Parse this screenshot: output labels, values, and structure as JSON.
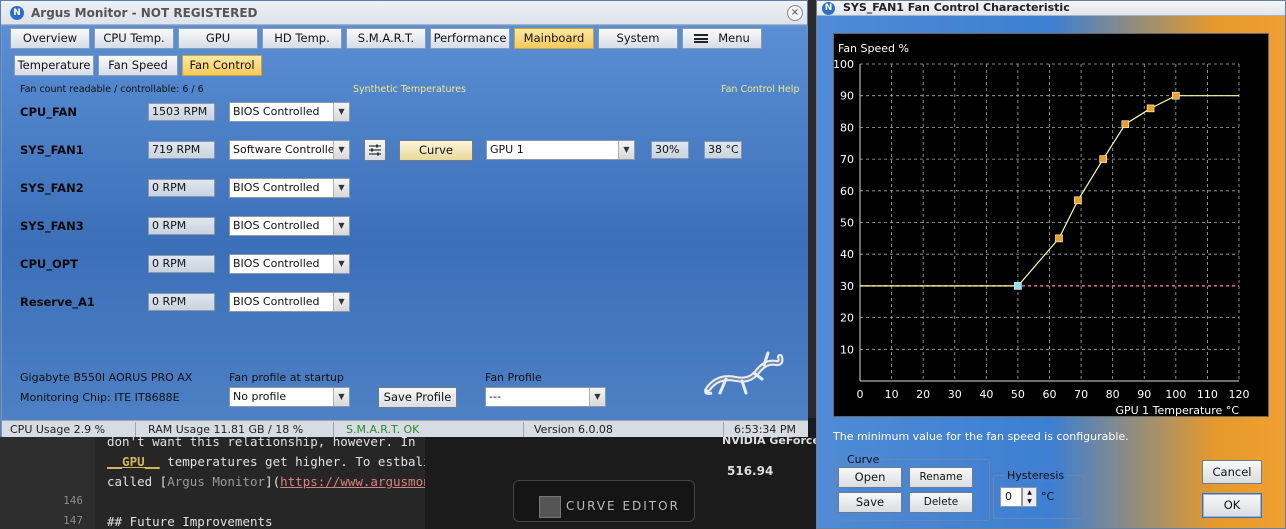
{
  "background": {
    "line_numbers": [
      "146",
      "147"
    ],
    "code_line1": "don't want this relationship, however. In",
    "code_line2_prefix": "",
    "code_line2_kw": "__GPU__",
    "code_line2_rest": " temperatures get higher. To estbalish this relationship, we have to use",
    "code_line3_prefix": "called [",
    "code_line3_link": "Argus Monitor",
    "code_line3_mid": "](",
    "code_line3_url": "https://www.argusmonitor.com",
    "code_line4": "## Future Improvements",
    "nvidia_label": "NVIDIA GeForce",
    "nvidia_value": "516.94",
    "curve_editor_label": "CURVE EDITOR"
  },
  "main_window": {
    "title": "Argus Monitor - NOT REGISTERED",
    "close_glyph": "×",
    "tabs": [
      "Overview",
      "CPU Temp.",
      "GPU",
      "HD Temp.",
      "S.M.A.R.T.",
      "Performance",
      "Mainboard",
      "System",
      "Menu"
    ],
    "active_tab": "Mainboard",
    "subtabs": [
      "Temperature",
      "Fan Speed",
      "Fan Control"
    ],
    "active_subtab": "Fan Control",
    "fan_count": "Fan count readable / controllable: 6 / 6",
    "synthetic_temps": "Synthetic Temperatures",
    "fan_help": "Fan Control Help",
    "fans": [
      {
        "name": "CPU_FAN",
        "rpm": "1503 RPM",
        "mode": "BIOS Controlled"
      },
      {
        "name": "SYS_FAN1",
        "rpm": "719 RPM",
        "mode": "Software Controlled"
      },
      {
        "name": "SYS_FAN2",
        "rpm": "0 RPM",
        "mode": "BIOS Controlled"
      },
      {
        "name": "SYS_FAN3",
        "rpm": "0 RPM",
        "mode": "BIOS Controlled"
      },
      {
        "name": "CPU_OPT",
        "rpm": "0 RPM",
        "mode": "BIOS Controlled"
      },
      {
        "name": "Reserve_A1",
        "rpm": "0 RPM",
        "mode": "BIOS Controlled"
      }
    ],
    "sys_fan1_controls": {
      "curve_label": "Curve",
      "source": "GPU 1",
      "percent": "30%",
      "temp": "38 °C"
    },
    "board": "Gigabyte B550I AORUS PRO AX",
    "chip": "Monitoring Chip: ITE IT8688E",
    "profile_startup_label": "Fan profile at startup",
    "profile_startup_value": "No profile",
    "save_profile": "Save Profile",
    "fan_profile_label": "Fan Profile",
    "fan_profile_value": "---",
    "status": {
      "cpu": "CPU Usage 2.9 %",
      "ram": "RAM Usage 11.81 GB / 18 %",
      "smart": "S.M.A.R.T. OK",
      "version": "Version 6.0.08",
      "time": "6:53:34 PM"
    }
  },
  "fan_control_window": {
    "title": "SYS_FAN1 Fan Control Characteristic",
    "close_glyph": "×",
    "note": "The minimum value for the fan speed is configurable.",
    "curve_group": "Curve",
    "buttons": {
      "open": "Open",
      "rename": "Rename",
      "save": "Save",
      "delete": "Delete",
      "cancel": "Cancel",
      "ok": "OK"
    },
    "hysteresis_label": "Hysteresis",
    "hysteresis_value": "0",
    "hysteresis_unit": "°C"
  },
  "chart_data": {
    "type": "line",
    "title": "",
    "ylabel": "Fan Speed %",
    "xlabel": "GPU 1  Temperature °C",
    "xlim": [
      0,
      120
    ],
    "ylim": [
      0,
      100
    ],
    "x_ticks": [
      0,
      10,
      20,
      30,
      40,
      50,
      60,
      70,
      80,
      90,
      100,
      110,
      120
    ],
    "y_ticks": [
      10,
      20,
      30,
      40,
      50,
      60,
      70,
      80,
      90,
      100
    ],
    "grid": true,
    "series": [
      {
        "points": [
          [
            0,
            30
          ],
          [
            50,
            30
          ],
          [
            63,
            45
          ],
          [
            69,
            57
          ],
          [
            77,
            70
          ],
          [
            84,
            81
          ],
          [
            92,
            86
          ],
          [
            100,
            90
          ],
          [
            120,
            90
          ]
        ],
        "control_points": [
          [
            50,
            30
          ],
          [
            63,
            45
          ],
          [
            69,
            57
          ],
          [
            77,
            70
          ],
          [
            84,
            81
          ],
          [
            92,
            86
          ],
          [
            100,
            90
          ]
        ],
        "color": "#ffff99"
      }
    ],
    "min_speed_line": 30,
    "min_speed_color": "#e07070"
  }
}
